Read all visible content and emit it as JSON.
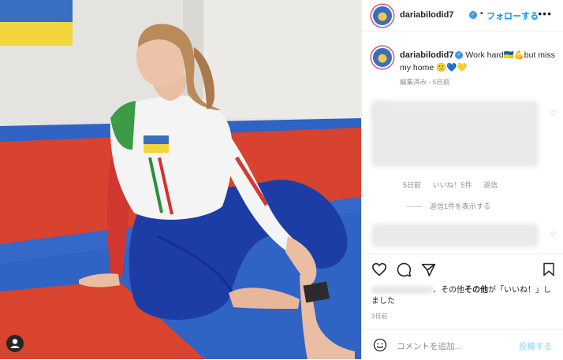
{
  "post": {
    "username": "dariabilodid7",
    "verified_icon": "verified-badge-icon",
    "separator": "•",
    "follow_label": "フォローする",
    "more_icon": "more-options-icon"
  },
  "caption": {
    "username": "dariabilodid7",
    "text": "Work hard🇺🇦💪but miss my home 🙂💙💛",
    "meta": "編集済み · 5日前"
  },
  "comments": [
    {
      "meta_time": "5日前",
      "meta_likes": "いいね！5件",
      "meta_reply": "返信",
      "view_replies": "返信1件を表示する"
    }
  ],
  "actions": {
    "like_icon": "heart-icon",
    "comment_icon": "comment-icon",
    "share_icon": "share-icon",
    "save_icon": "bookmark-icon"
  },
  "likes": {
    "text": "、その他",
    "bold": "が「いいね！」しました"
  },
  "date": "3日前",
  "comment_box": {
    "emoji_icon": "emoji-icon",
    "placeholder": "コメントを追加...",
    "post_label": "投稿する"
  },
  "colors": {
    "link_blue": "#0095f6",
    "disabled_blue": "#b2dffc",
    "mat_red": "#d9412f",
    "mat_blue": "#2a5fbf"
  }
}
